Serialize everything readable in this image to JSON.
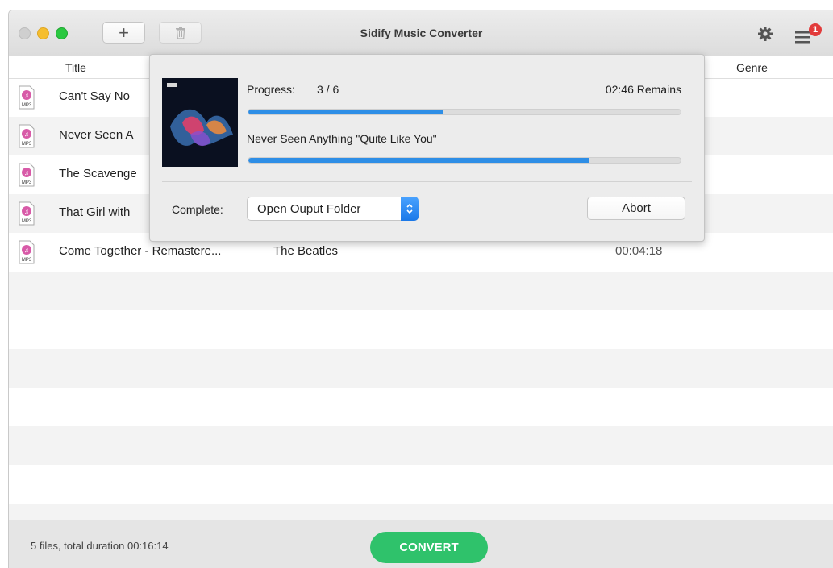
{
  "app": {
    "title": "Sidify Music Converter"
  },
  "toolbar": {
    "add_glyph": "+",
    "notification_count": "1"
  },
  "columns": {
    "title": "Title",
    "genre": "Genre"
  },
  "tracks": [
    {
      "title": "Can't Say No",
      "artist": "",
      "duration": ""
    },
    {
      "title": "Never Seen A",
      "artist": "",
      "duration": ""
    },
    {
      "title": "The Scavenge",
      "artist": "",
      "duration": ""
    },
    {
      "title": "That Girl with",
      "artist": "",
      "duration": ""
    },
    {
      "title": "Come Together - Remastere...",
      "artist": "The Beatles",
      "duration": "00:04:18"
    }
  ],
  "progress": {
    "label": "Progress:",
    "count": "3 / 6",
    "remains": "02:46 Remains",
    "overall_fraction": 0.45,
    "current_track": "Never Seen Anything \"Quite Like You\"",
    "track_fraction": 0.79
  },
  "completion": {
    "label": "Complete:",
    "selected_option": "Open Ouput Folder",
    "abort_label": "Abort"
  },
  "footer": {
    "summary": "5 files, total duration 00:16:14",
    "convert_label": "CONVERT"
  },
  "colors": {
    "accent_blue": "#2e8ee6",
    "convert_green": "#2fc26b",
    "badge_red": "#e23b3b"
  }
}
